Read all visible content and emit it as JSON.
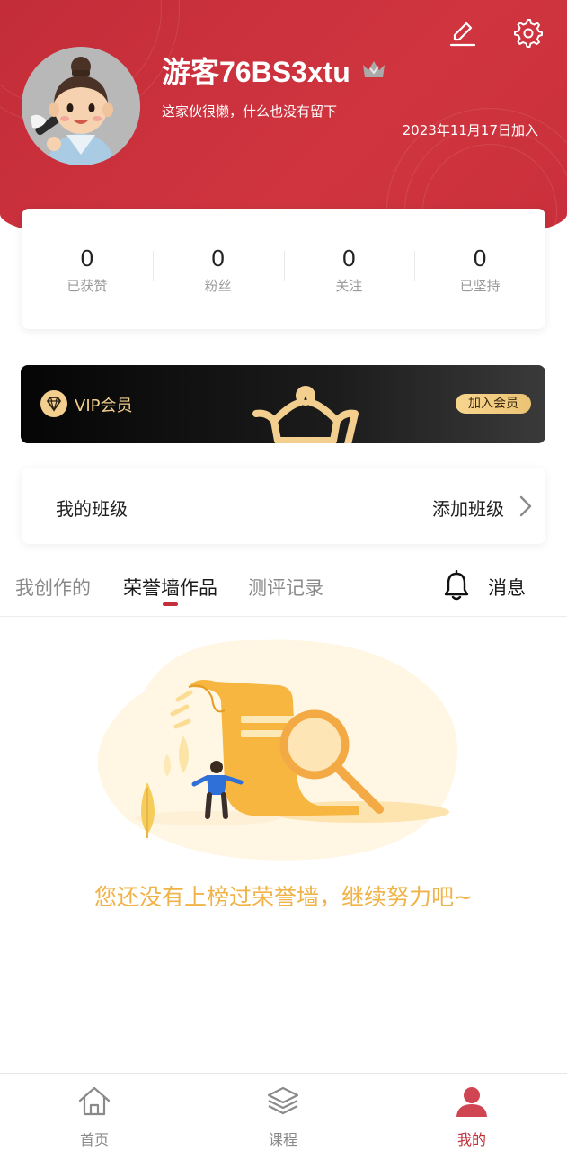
{
  "profile": {
    "username": "游客76BS3xtu",
    "bio": "这家伙很懒，什么也没有留下",
    "joined": "2023年11月17日加入",
    "accent_color": "#c92f3a"
  },
  "header_icons": {
    "edit": "edit-icon",
    "settings": "gear-icon"
  },
  "stats": [
    {
      "value": "0",
      "label": "已获赞"
    },
    {
      "value": "0",
      "label": "粉丝"
    },
    {
      "value": "0",
      "label": "关注"
    },
    {
      "value": "0",
      "label": "已坚持"
    }
  ],
  "vip": {
    "label": "VIP会员",
    "join_button": "加入会员",
    "gold_color": "#f2cf8e"
  },
  "class_card": {
    "title": "我的班级",
    "action": "添加班级"
  },
  "tabs": [
    {
      "label": "我创作的",
      "active": false
    },
    {
      "label": "荣誉墙作品",
      "active": true
    },
    {
      "label": "测评记录",
      "active": false
    }
  ],
  "messages": {
    "label": "消息",
    "icon": "bell-icon"
  },
  "empty_state": {
    "text": "您还没有上榜过荣誉墙，继续努力吧~",
    "text_color": "#f0b348"
  },
  "bottom_nav": [
    {
      "label": "首页",
      "icon": "home-icon",
      "active": false
    },
    {
      "label": "课程",
      "icon": "layers-icon",
      "active": false
    },
    {
      "label": "我的",
      "icon": "profile-icon",
      "active": true
    }
  ]
}
